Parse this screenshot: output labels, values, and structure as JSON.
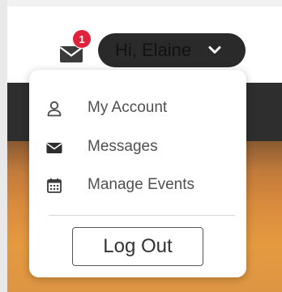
{
  "header": {
    "notification_count": "1",
    "greeting": "Hi, Elaine"
  },
  "menu": {
    "items": [
      {
        "icon": "user-icon",
        "label": "My Account"
      },
      {
        "icon": "envelope-icon",
        "label": "Messages"
      },
      {
        "icon": "calendar-icon",
        "label": "Manage Events"
      }
    ],
    "logout_label": "Log Out"
  },
  "colors": {
    "badge": "#e2223b",
    "pill": "#2a2a2a",
    "menu_text": "#505050"
  }
}
